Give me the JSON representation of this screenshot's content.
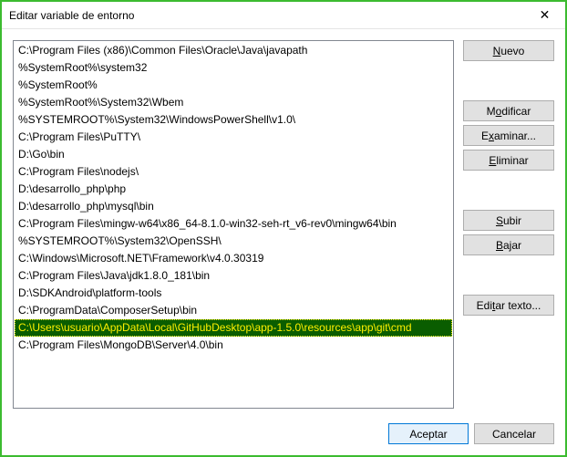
{
  "window": {
    "title": "Editar variable de entorno",
    "close_icon": "✕"
  },
  "list": {
    "items": [
      "C:\\Program Files (x86)\\Common Files\\Oracle\\Java\\javapath",
      "%SystemRoot%\\system32",
      "%SystemRoot%",
      "%SystemRoot%\\System32\\Wbem",
      "%SYSTEMROOT%\\System32\\WindowsPowerShell\\v1.0\\",
      "C:\\Program Files\\PuTTY\\",
      "D:\\Go\\bin",
      "C:\\Program Files\\nodejs\\",
      "D:\\desarrollo_php\\php",
      "D:\\desarrollo_php\\mysql\\bin",
      "C:\\Program Files\\mingw-w64\\x86_64-8.1.0-win32-seh-rt_v6-rev0\\mingw64\\bin",
      "%SYSTEMROOT%\\System32\\OpenSSH\\",
      "C:\\Windows\\Microsoft.NET\\Framework\\v4.0.30319",
      "C:\\Program Files\\Java\\jdk1.8.0_181\\bin",
      "D:\\SDKAndroid\\platform-tools",
      "C:\\ProgramData\\ComposerSetup\\bin",
      "C:\\Users\\usuario\\AppData\\Local\\GitHubDesktop\\app-1.5.0\\resources\\app\\git\\cmd",
      "C:\\Program Files\\MongoDB\\Server\\4.0\\bin"
    ],
    "selected_index": 16
  },
  "buttons": {
    "new": {
      "pre": "",
      "u": "N",
      "post": "uevo"
    },
    "edit": {
      "pre": "M",
      "u": "o",
      "post": "dificar"
    },
    "browse": {
      "pre": "E",
      "u": "x",
      "post": "aminar..."
    },
    "delete": {
      "pre": "",
      "u": "E",
      "post": "liminar"
    },
    "up": {
      "pre": "",
      "u": "S",
      "post": "ubir"
    },
    "down": {
      "pre": "",
      "u": "B",
      "post": "ajar"
    },
    "edit_text": {
      "pre": "Edi",
      "u": "t",
      "post": "ar texto..."
    },
    "ok": {
      "label": "Aceptar"
    },
    "cancel": {
      "label": "Cancelar"
    }
  }
}
